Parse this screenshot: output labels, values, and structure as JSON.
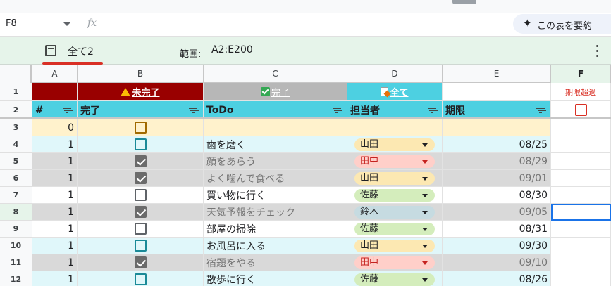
{
  "formula_bar": {
    "cell_ref": "F8",
    "fx_label": "fx",
    "ai_button_label": "この表を要約"
  },
  "table_bar": {
    "view_name": "全て2",
    "range_label": "範囲:",
    "range_value": "A2:E200"
  },
  "columns": [
    "A",
    "B",
    "C",
    "D",
    "E",
    "F"
  ],
  "active_column": "F",
  "active_row": "8",
  "row1": {
    "row_num": "1",
    "btn_incomplete": "未完了",
    "btn_complete": "完了",
    "btn_all": "全て",
    "overdue_label": "期限超過"
  },
  "header": {
    "row_num": "2",
    "col_a": "#",
    "col_b": "完了",
    "col_c": "ToDo",
    "col_d": "担当者",
    "col_e": "期限"
  },
  "rows": [
    {
      "row_num": "3",
      "num": "0",
      "done": false,
      "todo": "",
      "person": "",
      "due": ""
    },
    {
      "row_num": "4",
      "num": "1",
      "done": false,
      "todo": "歯を磨く",
      "person": "山田",
      "due": "08/25"
    },
    {
      "row_num": "5",
      "num": "1",
      "done": true,
      "todo": "顔をあらう",
      "person": "田中",
      "due": "08/29"
    },
    {
      "row_num": "6",
      "num": "1",
      "done": true,
      "todo": "よく噛んで食べる",
      "person": "山田",
      "due": "09/01"
    },
    {
      "row_num": "7",
      "num": "1",
      "done": false,
      "todo": "買い物に行く",
      "person": "佐藤",
      "due": "08/30"
    },
    {
      "row_num": "8",
      "num": "1",
      "done": true,
      "todo": "天気予報をチェック",
      "person": "鈴木",
      "due": "09/05"
    },
    {
      "row_num": "9",
      "num": "1",
      "done": false,
      "todo": "部屋の掃除",
      "person": "佐藤",
      "due": "08/31"
    },
    {
      "row_num": "10",
      "num": "1",
      "done": false,
      "todo": "お風呂に入る",
      "person": "山田",
      "due": "09/30"
    },
    {
      "row_num": "11",
      "num": "1",
      "done": true,
      "todo": "宿題をやる",
      "person": "田中",
      "due": "09/10"
    },
    {
      "row_num": "12",
      "num": "1",
      "done": false,
      "todo": "散歩に行く",
      "person": "佐藤",
      "due": "08/26"
    }
  ],
  "colors": {
    "incomplete_btn_bg": "#990000",
    "complete_btn_bg": "#b7b7b7",
    "all_btn_bg": "#4dd0e1",
    "header_bg": "#4dd0e1",
    "done_row_bg": "#d9d9d9",
    "light_row_bg": "#e0f7fa",
    "first_row_bg": "#fff2cc",
    "chip_yamada": "#fce8b2",
    "chip_tanaka": "#ffcfc9",
    "chip_sato": "#d4edbc",
    "chip_suzuki": "#c6dbe1",
    "chip_caret_tanaka": "#c5221f"
  },
  "icons": {
    "incomplete": "warning-icon",
    "complete": "checkbox-icon",
    "all": "document-icon"
  }
}
